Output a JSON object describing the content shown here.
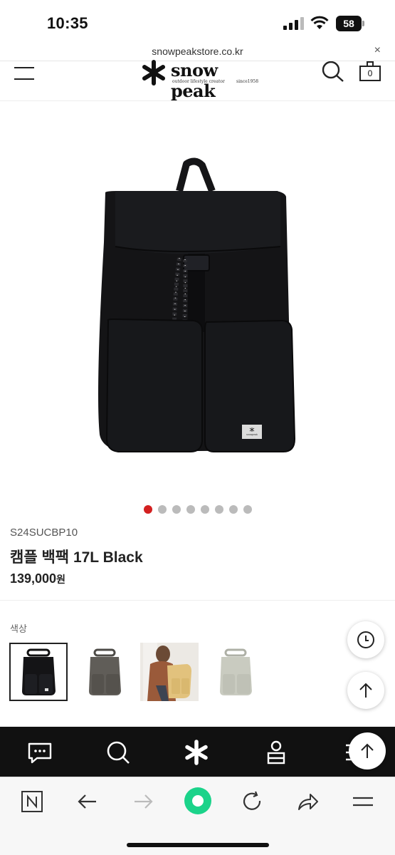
{
  "status_bar": {
    "time": "10:35",
    "battery": "58"
  },
  "browser": {
    "url": "snowpeakstore.co.kr",
    "close_label": "×"
  },
  "header": {
    "logo_text": "snow peak",
    "logo_tagline": "outdoor lifestyle creator",
    "logo_since": "since1958",
    "cart_count": "0"
  },
  "gallery": {
    "slide_count": 8,
    "active_index": 0
  },
  "product": {
    "sku": "S24SUCBP10",
    "name": "캠플 백팩 17L Black",
    "price": "139,000",
    "currency": "원",
    "bag_label": "snowpeak"
  },
  "options": {
    "color_label": "색상",
    "swatches": [
      "black",
      "gray",
      "beige-model",
      "light-gray"
    ]
  },
  "colors": {
    "accent": "#d32020",
    "dot_inactive": "#bbbbbb",
    "bag": "#141416",
    "sitebar": "#111111",
    "browser_home": "#1bd38a"
  },
  "icons": {
    "fab_history": "clock-icon",
    "fab_top": "arrow-up-icon",
    "sitebar": [
      "chat-icon",
      "search-icon",
      "snowpeak-logo-icon",
      "person-icon",
      "menu-icon"
    ],
    "browser": [
      "naver-n-icon",
      "back-icon",
      "forward-icon",
      "home-icon",
      "reload-icon",
      "share-icon",
      "menu-icon"
    ]
  }
}
